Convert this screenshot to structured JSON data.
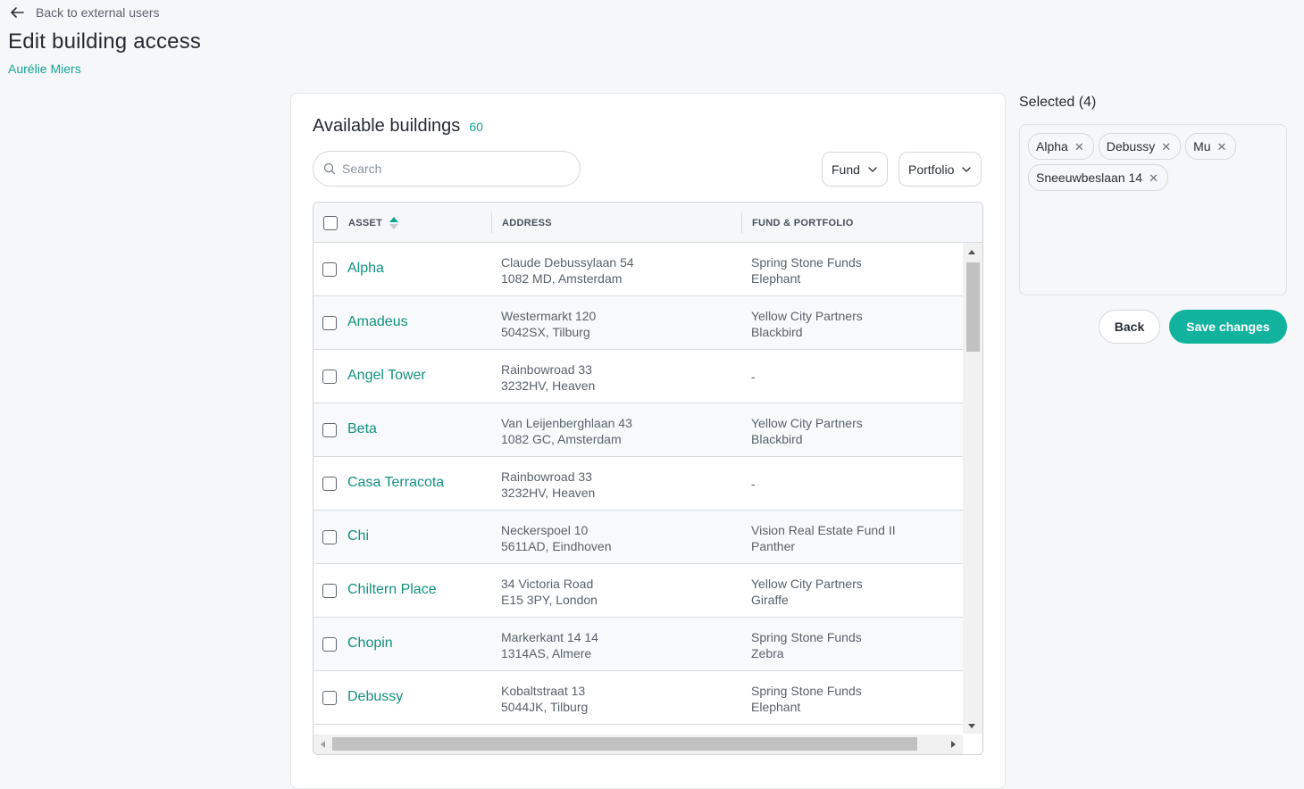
{
  "nav": {
    "back_label": "Back to external users",
    "back_icon": "arrow-left-icon"
  },
  "page": {
    "title": "Edit building access",
    "user": "Aurélie Miers"
  },
  "colors": {
    "accent": "#12a594",
    "save_button": "#12b39e"
  },
  "available": {
    "title": "Available buildings",
    "count": "60",
    "search_placeholder": "Search",
    "filters": {
      "fund": "Fund",
      "portfolio": "Portfolio"
    },
    "columns": {
      "asset": "ASSET",
      "address": "ADDRESS",
      "fund": "FUND & PORTFOLIO"
    },
    "rows": [
      {
        "asset": "Alpha",
        "addr1": "Claude Debussylaan 54",
        "addr2": "1082 MD, Amsterdam",
        "fund1": "Spring Stone Funds",
        "fund2": "Elephant"
      },
      {
        "asset": "Amadeus",
        "addr1": "Westermarkt 120",
        "addr2": "5042SX, Tilburg",
        "fund1": "Yellow City Partners",
        "fund2": "Blackbird"
      },
      {
        "asset": "Angel Tower",
        "addr1": "Rainbowroad 33",
        "addr2": "3232HV, Heaven",
        "fund1": "-",
        "fund2": ""
      },
      {
        "asset": "Beta",
        "addr1": "Van Leijenberghlaan 43",
        "addr2": "1082 GC, Amsterdam",
        "fund1": "Yellow City Partners",
        "fund2": "Blackbird"
      },
      {
        "asset": "Casa Terracota",
        "addr1": "Rainbowroad 33",
        "addr2": "3232HV, Heaven",
        "fund1": "-",
        "fund2": ""
      },
      {
        "asset": "Chi",
        "addr1": "Neckerspoel 10",
        "addr2": "5611AD, Eindhoven",
        "fund1": "Vision Real Estate Fund II",
        "fund2": "Panther"
      },
      {
        "asset": "Chiltern Place",
        "addr1": "34 Victoria Road",
        "addr2": "E15 3PY, London",
        "fund1": "Yellow City Partners",
        "fund2": "Giraffe"
      },
      {
        "asset": "Chopin",
        "addr1": "Markerkant 14 14",
        "addr2": "1314AS, Almere",
        "fund1": "Spring Stone Funds",
        "fund2": "Zebra"
      },
      {
        "asset": "Debussy",
        "addr1": "Kobaltstraat 13",
        "addr2": "5044JK, Tilburg",
        "fund1": "Spring Stone Funds",
        "fund2": "Elephant"
      }
    ]
  },
  "selected": {
    "title": "Selected (4)",
    "chips": [
      "Alpha",
      "Debussy",
      "Mu",
      "Sneeuwbeslaan 14"
    ]
  },
  "actions": {
    "back": "Back",
    "save": "Save changes"
  }
}
